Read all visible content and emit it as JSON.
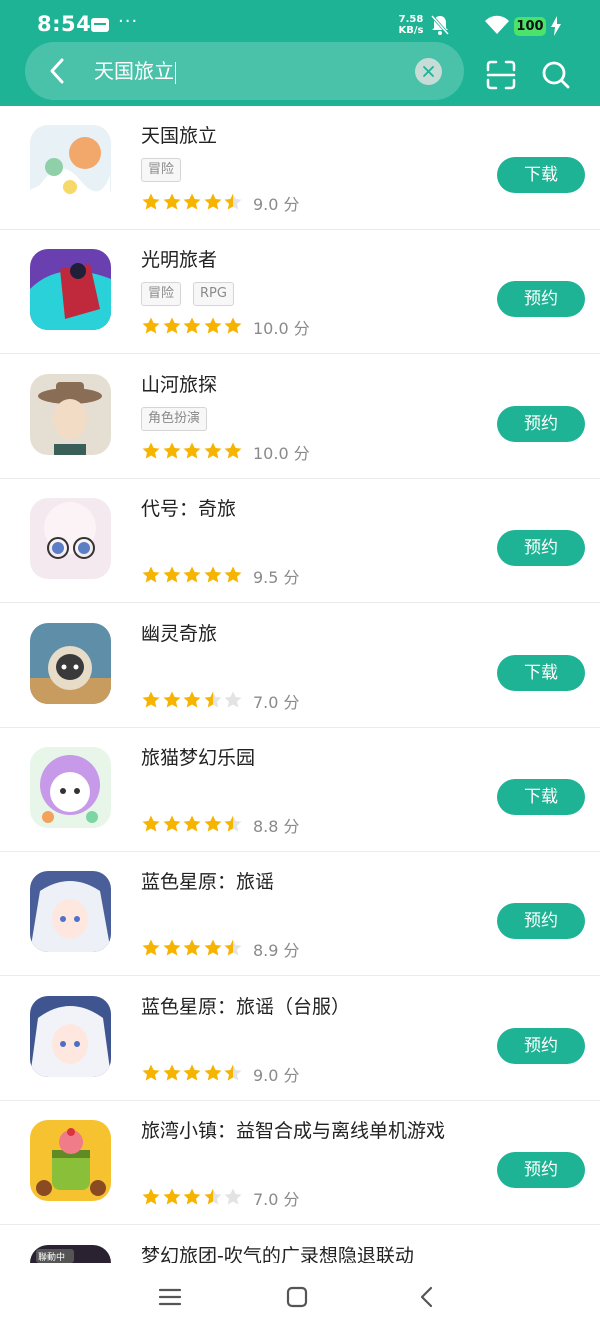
{
  "status_bar": {
    "time": "8:54",
    "dots": "···",
    "net_speed_value": "7.58",
    "net_speed_unit": "KB/s",
    "battery": "100"
  },
  "search": {
    "query": "天国旅立"
  },
  "results": [
    {
      "title": "天国旅立",
      "tags": [
        "冒险"
      ],
      "rating": 4.5,
      "score": "9.0 分",
      "action": "下载",
      "icon": "game-icon-tengoku-tabidachi"
    },
    {
      "title": "光明旅者",
      "tags": [
        "冒险",
        "RPG"
      ],
      "rating": 5,
      "score": "10.0 分",
      "action": "预约",
      "icon": "game-icon-guangming-lvzhe"
    },
    {
      "title": "山河旅探",
      "tags": [
        "角色扮演"
      ],
      "rating": 5,
      "score": "10.0 分",
      "action": "预约",
      "icon": "game-icon-shanhe-lvtan"
    },
    {
      "title": "代号：奇旅",
      "tags": [],
      "rating": 5,
      "score": "9.5 分",
      "action": "预约",
      "icon": "game-icon-daihao-qilv"
    },
    {
      "title": "幽灵奇旅",
      "tags": [],
      "rating": 3.5,
      "score": "7.0 分",
      "action": "下载",
      "icon": "game-icon-youling-qilv"
    },
    {
      "title": "旅猫梦幻乐园",
      "tags": [],
      "rating": 4.5,
      "score": "8.8 分",
      "action": "下载",
      "icon": "game-icon-lvmao"
    },
    {
      "title": "蓝色星原：旅谣",
      "tags": [],
      "rating": 4.5,
      "score": "8.9 分",
      "action": "预约",
      "icon": "game-icon-lanse-xingyuan"
    },
    {
      "title": "蓝色星原：旅谣（台服）",
      "tags": [],
      "rating": 4.5,
      "score": "9.0 分",
      "action": "预约",
      "icon": "game-icon-lanse-xingyuan-tw"
    },
    {
      "title": "旅湾小镇：益智合成与离线单机游戏",
      "tags": [],
      "rating": 3.5,
      "score": "7.0 分",
      "action": "预约",
      "icon": "game-icon-lvwan-xiaozhen"
    },
    {
      "title": "梦幻旅团-吹气的广录想隐退联动",
      "tags": [],
      "icon": "game-icon-menghuan-lvtuan",
      "badge": "聯動中"
    }
  ],
  "colors": {
    "brand": "#1db394",
    "star": "#f6b400",
    "star_empty": "#e3e3e3"
  }
}
